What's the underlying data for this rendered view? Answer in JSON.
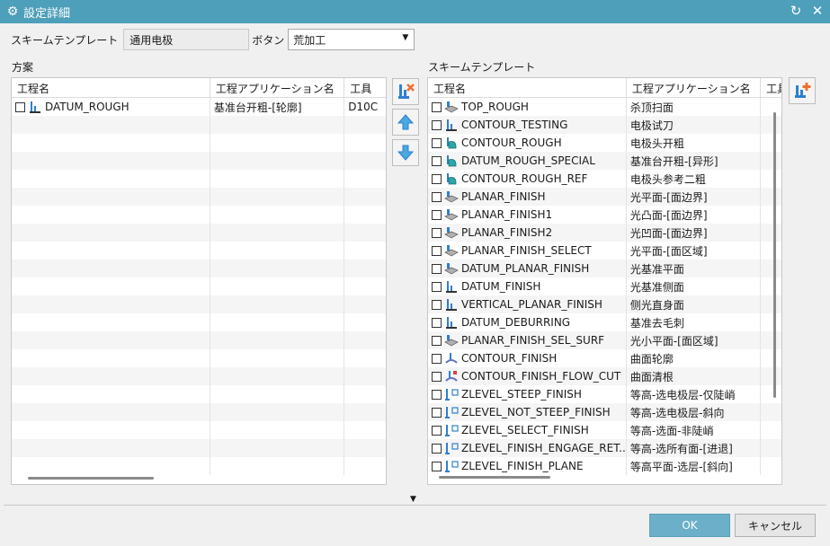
{
  "window": {
    "title": "設定詳細",
    "icon": "gear-icon"
  },
  "toprow": {
    "template_label": "スキームテンプレート",
    "template_value": "通用电极",
    "button_label": "ボタン",
    "button_value": "荒加工"
  },
  "left": {
    "label": "方案",
    "columns": [
      "工程名",
      "工程アプリケーション名",
      "工具"
    ],
    "rows": [
      {
        "name": "DATUM_ROUGH",
        "app": "基准台开粗-[轮廓]",
        "tool": "D10C",
        "icon": "mill-planar"
      }
    ]
  },
  "right": {
    "label": "スキームテンプレート",
    "columns": [
      "工程名",
      "工程アプリケーション名",
      "工具"
    ],
    "rows": [
      {
        "name": "TOP_ROUGH",
        "app": "杀顶扫面",
        "icon": "face-mill"
      },
      {
        "name": "CONTOUR_TESTING",
        "app": "电极试刀",
        "icon": "mill-planar"
      },
      {
        "name": "CONTOUR_ROUGH",
        "app": "电极头开粗",
        "icon": "cavity-mill"
      },
      {
        "name": "DATUM_ROUGH_SPECIAL",
        "app": "基准台开粗-[异形]",
        "icon": "cavity-mill"
      },
      {
        "name": "CONTOUR_ROUGH_REF",
        "app": "电极头参考二粗",
        "icon": "cavity-mill"
      },
      {
        "name": "PLANAR_FINISH",
        "app": "光平面-[面边界]",
        "icon": "face-mill"
      },
      {
        "name": "PLANAR_FINISH1",
        "app": "光凸面-[面边界]",
        "icon": "face-mill"
      },
      {
        "name": "PLANAR_FINISH2",
        "app": "光凹面-[面边界]",
        "icon": "face-mill"
      },
      {
        "name": "PLANAR_FINISH_SELECT",
        "app": "光平面-[面区域]",
        "icon": "face-mill"
      },
      {
        "name": "DATUM_PLANAR_FINISH",
        "app": "光基准平面",
        "icon": "face-mill"
      },
      {
        "name": "DATUM_FINISH",
        "app": "光基准侧面",
        "icon": "mill-planar"
      },
      {
        "name": "VERTICAL_PLANAR_FINISH",
        "app": "侧光直身面",
        "icon": "mill-planar"
      },
      {
        "name": "DATUM_DEBURRING",
        "app": "基准去毛刺",
        "icon": "mill-planar"
      },
      {
        "name": "PLANAR_FINISH_SEL_SURF",
        "app": "光小平面-[面区域]",
        "icon": "face-mill"
      },
      {
        "name": "CONTOUR_FINISH",
        "app": "曲面轮廓",
        "icon": "contour"
      },
      {
        "name": "CONTOUR_FINISH_FLOW_CUT",
        "app": "曲面清根",
        "icon": "flowcut"
      },
      {
        "name": "ZLEVEL_STEEP_FINISH",
        "app": "等高-选电极层-仅陡峭",
        "icon": "zlevel"
      },
      {
        "name": "ZLEVEL_NOT_STEEP_FINISH",
        "app": "等高-选电极层-斜向",
        "icon": "zlevel"
      },
      {
        "name": "ZLEVEL_SELECT_FINISH",
        "app": "等高-选面-非陡峭",
        "icon": "zlevel"
      },
      {
        "name": "ZLEVEL_FINISH_ENGAGE_RET...",
        "app": "等高-选所有面-[进退]",
        "icon": "zlevel"
      },
      {
        "name": "ZLEVEL_FINISH_PLANE",
        "app": "等高平面-选层-[斜向]",
        "icon": "zlevel"
      }
    ]
  },
  "buttons": {
    "ok": "OK",
    "cancel": "キャンセル"
  },
  "colors": {
    "titlebar": "#4e9fba",
    "ok": "#6bb0c8",
    "accent_blue": "#2f7fd0",
    "accent_orange": "#f07030"
  }
}
